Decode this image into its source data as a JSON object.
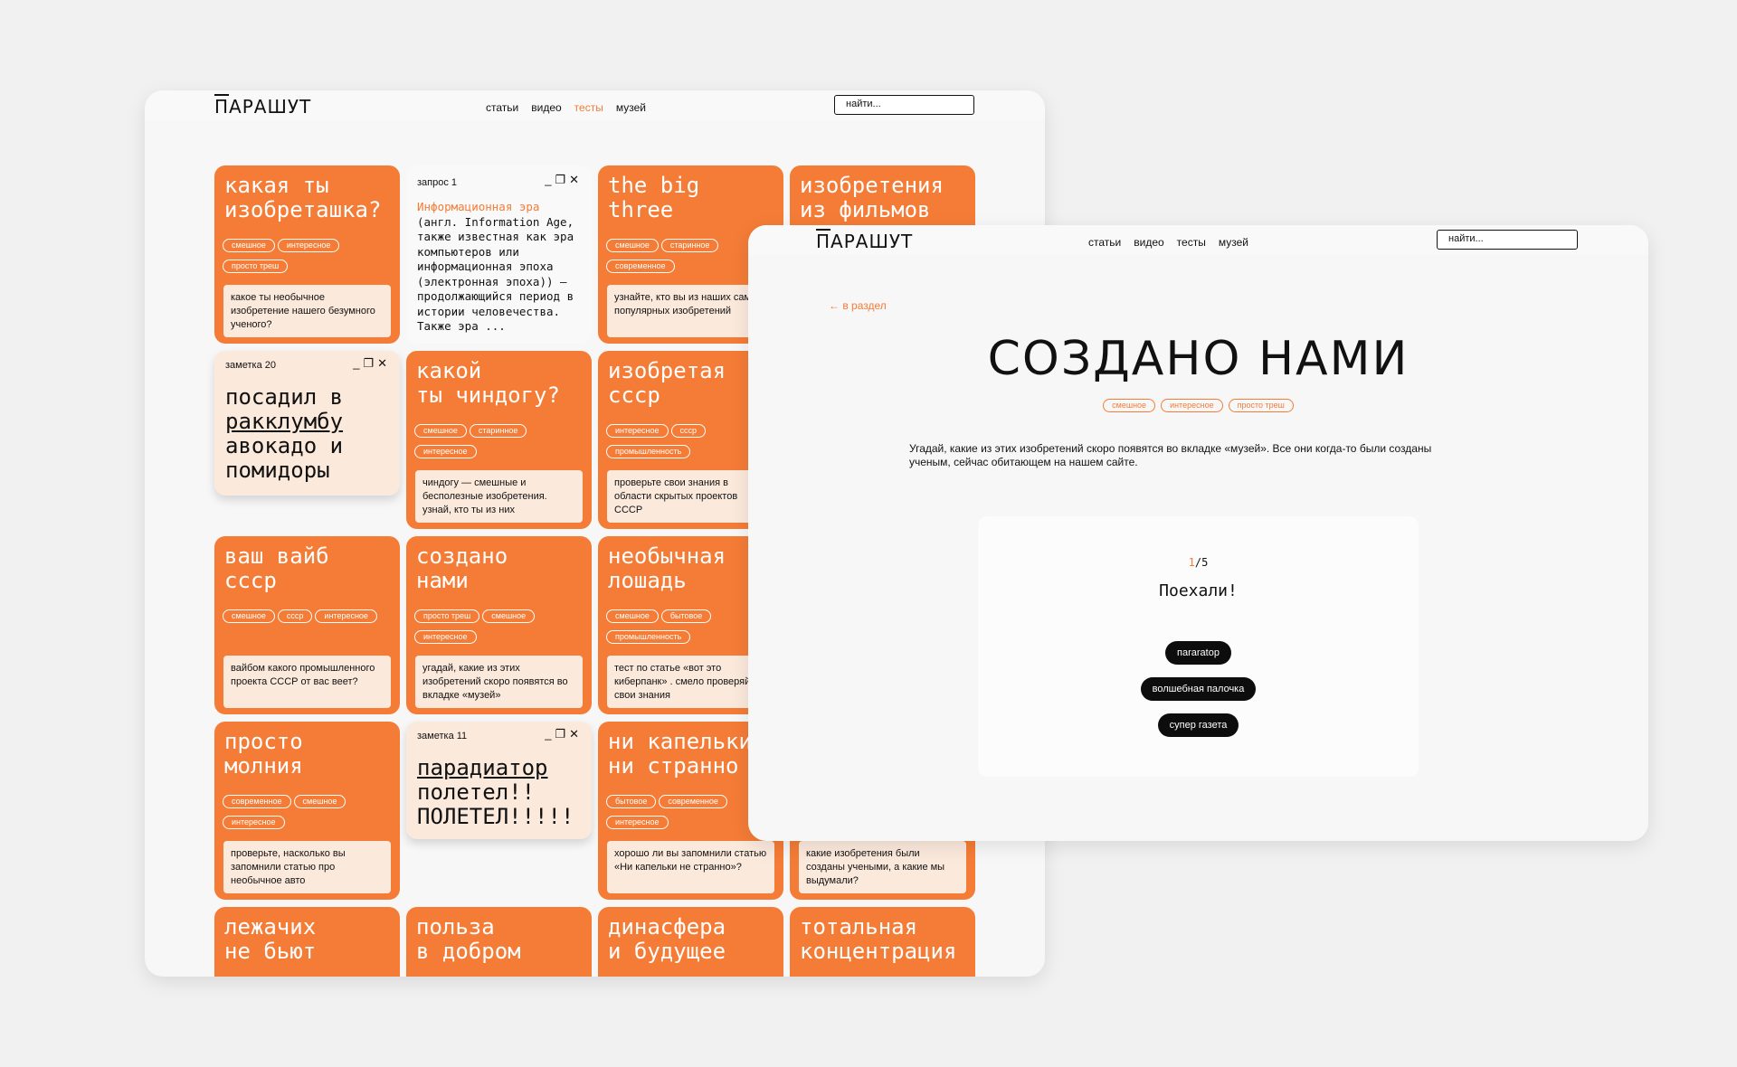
{
  "site": {
    "logo_prefix": "П",
    "logo_rest": "АРАШУТ",
    "nav": [
      "статьи",
      "видео",
      "тесты",
      "музей"
    ],
    "search_placeholder": "найти..."
  },
  "colors": {
    "accent": "#f47c36",
    "note_bg": "#fbe9dc",
    "button_bg": "#0d0d0d"
  },
  "cards": [
    {
      "title": "какая ты\nизобреташка?",
      "tags": [
        "смешное",
        "интересное",
        "просто треш"
      ],
      "desc": "какое ты необычное изобретение нашего безумного ученого?"
    },
    {
      "title": "the big\nthree",
      "tags": [
        "смешное",
        "старинное",
        "современное"
      ],
      "desc": "узнайте, кто вы из наших самых популярных изобретений"
    },
    {
      "title": "изобретения\nиз фильмов",
      "tags": [],
      "desc": ""
    },
    {
      "title": "какой\nты чиндогу?",
      "tags": [
        "смешное",
        "старинное",
        "интересное"
      ],
      "desc": "чиндогу — смешные и бесполезные изобретения. узнай, кто ты из них"
    },
    {
      "title": "изобретая\nссср",
      "tags": [
        "интересное",
        "ссср",
        "промышленность"
      ],
      "desc": "проверьте свои знания в области скрытых проектов СССР"
    },
    {
      "title": "ваш вайб\nссср",
      "tags": [
        "смешное",
        "ссср",
        "интересное"
      ],
      "desc": "вайбом какого промышленного проекта СССР от вас веет?"
    },
    {
      "title": "создано\nнами",
      "tags": [
        "просто треш",
        "смешное",
        "интересное"
      ],
      "desc": "угадай, какие из этих изобретений скоро появятся во вкладке «музей»"
    },
    {
      "title": "необычная\nлошадь",
      "tags": [
        "смешное",
        "бытовое",
        "промышленность"
      ],
      "desc": "тест по статье «вот это киберпанк» . смело проверяйте свои знания"
    },
    {
      "title": "просто\nмолния",
      "tags": [
        "современное",
        "смешное",
        "интересное"
      ],
      "desc": "проверьте, насколько вы запомнили статью про необычное авто"
    },
    {
      "title": "ни капельки\nни странно",
      "tags": [
        "бытовое",
        "современное",
        "интересное"
      ],
      "desc": "хорошо ли вы запомнили статью «Ни капельки не странно»?"
    },
    {
      "title": "",
      "tags": [],
      "desc": "какие изобретения были созданы учеными, а какие мы выдумали?"
    },
    {
      "title": "лежачих\nне бьют",
      "tags": [],
      "desc": ""
    },
    {
      "title": "польза\nв добром",
      "tags": [],
      "desc": ""
    },
    {
      "title": "динасфера\nи будущее",
      "tags": [],
      "desc": ""
    },
    {
      "title": "тотальная\nконцентрация",
      "tags": [],
      "desc": ""
    }
  ],
  "request": {
    "header": "запрос 1",
    "highlight": "Информационная эра",
    "body": "(англ. Information Age, также известная как эра компьютеров или информационная эпоха (электронная эпоха)) — продолжающийся период в истории человечества. Также эра ..."
  },
  "notes": [
    {
      "header": "заметка 20",
      "underline": "ракклумбу",
      "line1": "посадил в",
      "line3": "авокадо и",
      "line4": "помидоры"
    },
    {
      "header": "заметка 11",
      "underline": "парадиатор",
      "line2": "полетел!!",
      "line3": "ПОЛЕТЕЛ!!!!!"
    }
  ],
  "window_icons": [
    "minimize-icon",
    "restore-icon",
    "close-icon"
  ],
  "quiz_page": {
    "back_link": "←  в раздел",
    "title": "СОЗДАНО НАМИ",
    "tags": [
      "смешное",
      "интересное",
      "просто треш"
    ],
    "description": "Угадай, какие из этих изобретений скоро появятся во вкладке «музей». Все они когда-то были созданы ученым, сейчас обитающем на нашем сайте.",
    "progress_current": "1",
    "progress_total": "/5",
    "question": "Поехали!",
    "answers": [
      "пararatop",
      "волшебная палочка",
      "супер газета"
    ]
  }
}
